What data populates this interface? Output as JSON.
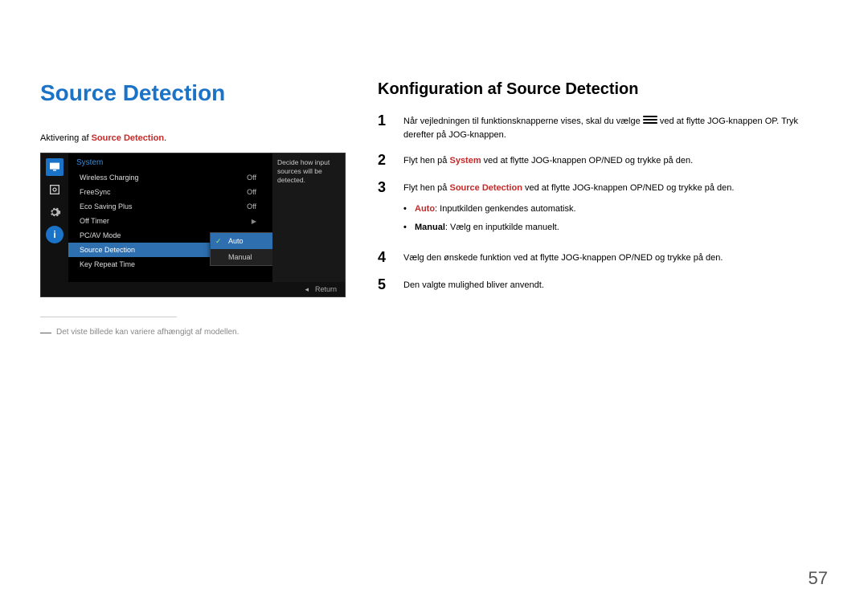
{
  "title": "Source Detection",
  "intro_prefix": "Aktivering af ",
  "intro_em": "Source Detection",
  "intro_suffix": ".",
  "osd": {
    "section": "System",
    "rows": [
      {
        "label": "Wireless Charging",
        "value": "Off"
      },
      {
        "label": "FreeSync",
        "value": "Off"
      },
      {
        "label": "Eco Saving Plus",
        "value": "Off"
      },
      {
        "label": "Off Timer",
        "value": "▶"
      },
      {
        "label": "PC/AV Mode",
        "value": "▶"
      },
      {
        "label": "Source Detection",
        "value": ""
      },
      {
        "label": "Key Repeat Time",
        "value": ""
      }
    ],
    "popup": {
      "options": [
        "Auto",
        "Manual"
      ],
      "selected": "Auto"
    },
    "desc": "Decide how input sources will be detected.",
    "return": "Return",
    "return_arrow": "◂"
  },
  "footnote": "Det viste billede kan variere afhængigt af modellen.",
  "subhead": "Konfiguration af Source Detection",
  "steps": {
    "s1a": "Når vejledningen til funktionsknapperne vises, skal du vælge ",
    "s1b": " ved at flytte JOG-knappen OP. Tryk derefter på JOG-knappen.",
    "s2a": "Flyt hen på ",
    "s2_em": "System",
    "s2b": " ved at flytte JOG-knappen OP/NED og trykke på den.",
    "s3a": "Flyt hen på ",
    "s3_em": "Source Detection",
    "s3b": " ved at flytte JOG-knappen OP/NED og trykke på den.",
    "sub1_em": "Auto",
    "sub1": ": Inputkilden genkendes automatisk.",
    "sub2_em": "Manual",
    "sub2": ": Vælg en inputkilde manuelt.",
    "s4": "Vælg den ønskede funktion ved at flytte JOG-knappen OP/NED og trykke på den.",
    "s5": "Den valgte mulighed bliver anvendt."
  },
  "nums": {
    "n1": "1",
    "n2": "2",
    "n3": "3",
    "n4": "4",
    "n5": "5"
  },
  "page_number": "57"
}
